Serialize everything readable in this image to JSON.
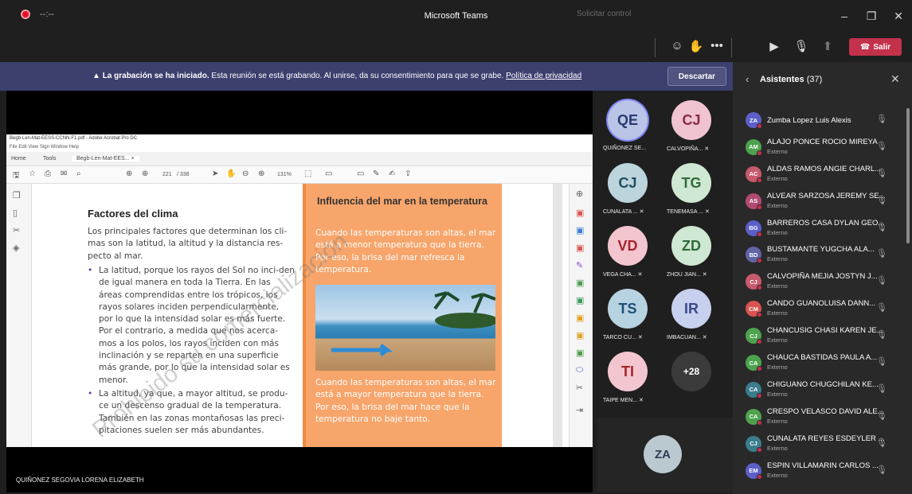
{
  "window": {
    "title": "Microsoft Teams"
  },
  "toolbar": {
    "rec_time": "--:--",
    "request_control": "Solicitar control",
    "leave_label": "Salir"
  },
  "banner": {
    "title": "La grabación se ha iniciado.",
    "text": "Esta reunión se está grabando. Al unirse, da su consentimiento para que se grabe.",
    "link": "Política de privacidad",
    "dismiss": "Descartar"
  },
  "shared_screen": {
    "acrobat_title": "Begb-Len-Mat-EESS-CCNN-F1.pdf - Adobe Acrobat Pro DC",
    "menu": "File  Edit  View  Sign  Window  Help",
    "tabs": [
      "Home",
      "Tools",
      "Begb-Len-Mat-EES... ×"
    ],
    "page_num": "221",
    "page_total": "/ 338",
    "zoom": "131%",
    "heading": "Factores del clima",
    "intro": "Los principales factores que determinan los cli-mas son la latitud, la altitud y la distancia res-pecto al mar.",
    "bullet1": "La latitud, porque los rayos del Sol no inci-den de igual manera en toda la Tierra. En las áreas comprendidas entre los trópicos, los rayos solares inciden perpendicularmente, por lo que la intensidad solar es más fuerte. Por el contrario, a medida que nos acerca-mos a los polos, los rayos inciden con más inclinación y se reparten en una superficie más grande, por lo que la intensidad solar es menor.",
    "bullet2": "La altitud, ya que, a mayor altitud, se produ-ce un descenso gradual de la temperatura. También en las zonas montañosas las preci-pitaciones suelen ser más abundantes.",
    "box_title": "Influencia del mar en la temperatura",
    "box_p1": "Cuando las temperaturas son altas, el mar está a menor temperatura que la tierra. Por eso, la brisa del mar refresca la temperatura.",
    "box_p2": "Cuando las temperaturas son altas, el mar está a mayor temperatura que la tierra. Por eso, la brisa del mar hace que la temperatura no baje tanto.",
    "watermark": "Prohibido su comercialización"
  },
  "presenter_name": "QUIÑONEZ SEGOVIA LORENA ELIZABETH",
  "gallery": [
    {
      "initials": "QE",
      "name": "QUIÑONEZ SE...",
      "bg": "#b9c4e6",
      "fg": "#2b3a6e",
      "ring": true,
      "muted": false
    },
    {
      "initials": "CJ",
      "name": "CALVOPIÑA...",
      "bg": "#efc3cf",
      "fg": "#8a2a47",
      "ring": false,
      "muted": true
    },
    {
      "initials": "CJ",
      "name": "CUNALATA ...",
      "bg": "#bcd4dc",
      "fg": "#1f4e5f",
      "ring": false,
      "muted": true
    },
    {
      "initials": "TG",
      "name": "TENEMASA ...",
      "bg": "#cfe8d3",
      "fg": "#2f6b3a",
      "ring": false,
      "muted": true
    },
    {
      "initials": "VD",
      "name": "VEGA CHA...",
      "bg": "#f3c6cf",
      "fg": "#a4262c",
      "ring": false,
      "muted": true
    },
    {
      "initials": "ZD",
      "name": "ZHOU JIAN...",
      "bg": "#cfe8d3",
      "fg": "#2f6b3a",
      "ring": false,
      "muted": true
    },
    {
      "initials": "TS",
      "name": "TARCO CU...",
      "bg": "#b7d2e0",
      "fg": "#1f4e79",
      "ring": false,
      "muted": true
    },
    {
      "initials": "IR",
      "name": "IMBACUAN...",
      "bg": "#c7d0ee",
      "fg": "#3b4a8a",
      "ring": false,
      "muted": true
    },
    {
      "initials": "TI",
      "name": "TAIPE MEN...",
      "bg": "#f3c6cf",
      "fg": "#a4262c",
      "ring": false,
      "muted": true
    },
    {
      "initials": "+28",
      "name": "",
      "bg": "#3b3b3b",
      "fg": "#ffffff",
      "ring": false,
      "muted": false
    }
  ],
  "self_tile": {
    "initials": "ZA"
  },
  "participants": {
    "title": "Asistentes",
    "count": "(37)",
    "list": [
      {
        "initials": "ZA",
        "name": "Zumba Lopez Luis Alexis",
        "sub": "",
        "color": "#5b5fc7"
      },
      {
        "initials": "AM",
        "name": "ALAJO PONCE ROCIO MIREYA",
        "sub": "Externo",
        "color": "#4ea34e"
      },
      {
        "initials": "AC",
        "name": "ALDAS RAMOS ANGIE CHARL...",
        "sub": "Externo",
        "color": "#c85a6e"
      },
      {
        "initials": "AS",
        "name": "ALVEAR SARZOSA JEREMY SE...",
        "sub": "Externo",
        "color": "#b04a74"
      },
      {
        "initials": "BG",
        "name": "BARREROS CASA DYLAN GEO...",
        "sub": "Externo",
        "color": "#5b5fc7"
      },
      {
        "initials": "BD",
        "name": "BUSTAMANTE YUGCHA ALA...",
        "sub": "Externo",
        "color": "#6264a7"
      },
      {
        "initials": "CJ",
        "name": "CALVOPIÑA MEJIA JOSTYN J...",
        "sub": "Externo",
        "color": "#c85a6e"
      },
      {
        "initials": "CM",
        "name": "CANDO GUANOLUISA DANN...",
        "sub": "Externo",
        "color": "#d9534f"
      },
      {
        "initials": "CJ",
        "name": "CHANCUSIG CHASI KAREN JE...",
        "sub": "Externo",
        "color": "#4ea34e"
      },
      {
        "initials": "CA",
        "name": "CHAUCA BASTIDAS PAULA A...",
        "sub": "Externo",
        "color": "#4ea34e"
      },
      {
        "initials": "CA",
        "name": "CHIGUANO CHUGCHILAN KE...",
        "sub": "Externo",
        "color": "#3a7d8c"
      },
      {
        "initials": "CA",
        "name": "CRESPO VELASCO DAVID ALE...",
        "sub": "Externo",
        "color": "#4ea34e"
      },
      {
        "initials": "CJ",
        "name": "CUNALATA REYES ESDEYLER ...",
        "sub": "Externo",
        "color": "#3a7d8c"
      },
      {
        "initials": "EM",
        "name": "ESPIN VILLAMARIN CARLOS ...",
        "sub": "Externo",
        "color": "#5b5fc7"
      }
    ]
  }
}
